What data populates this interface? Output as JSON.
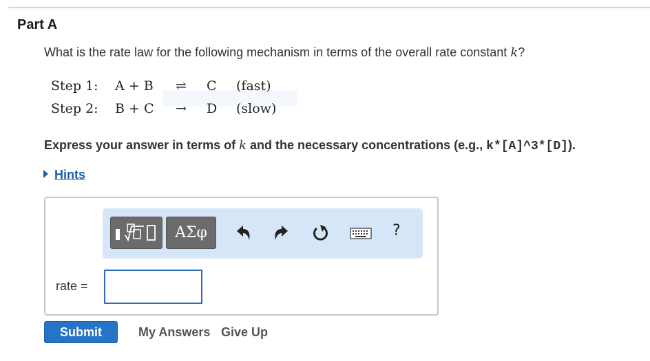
{
  "part_title": "Part A",
  "question": {
    "text": "What is the rate law for the following mechanism in terms of the overall rate constant ",
    "variable": "k",
    "suffix": "?"
  },
  "mechanism": [
    {
      "step": "Step 1:",
      "reactants": "A + B",
      "arrow": "⇌",
      "product": "C",
      "speed": "(fast)"
    },
    {
      "step": "Step 2:",
      "reactants": "B + C",
      "arrow": "→",
      "product": "D",
      "speed": "(slow)"
    }
  ],
  "instructions": {
    "prefix": "Express your answer in terms of ",
    "variable": "k",
    "middle": " and the necessary concentrations (e.g., ",
    "example": "k*[A]^3*[D]",
    "suffix": ")."
  },
  "hints_label": "Hints",
  "toolbar": {
    "greek_label": "ΑΣφ",
    "help_label": "?",
    "icons": [
      "templates-icon",
      "undo-icon",
      "redo-icon",
      "reset-icon",
      "keyboard-icon",
      "help-icon"
    ]
  },
  "answer": {
    "label": "rate =",
    "value": ""
  },
  "actions": {
    "submit": "Submit",
    "my_answers": "My Answers",
    "give_up": "Give Up"
  },
  "colors": {
    "accent": "#2674c6",
    "link": "#1a5fa8",
    "toolbar_bg": "#d5e6f8",
    "toolbar_button": "#6b6b6b",
    "input_border": "#2e6db4"
  }
}
